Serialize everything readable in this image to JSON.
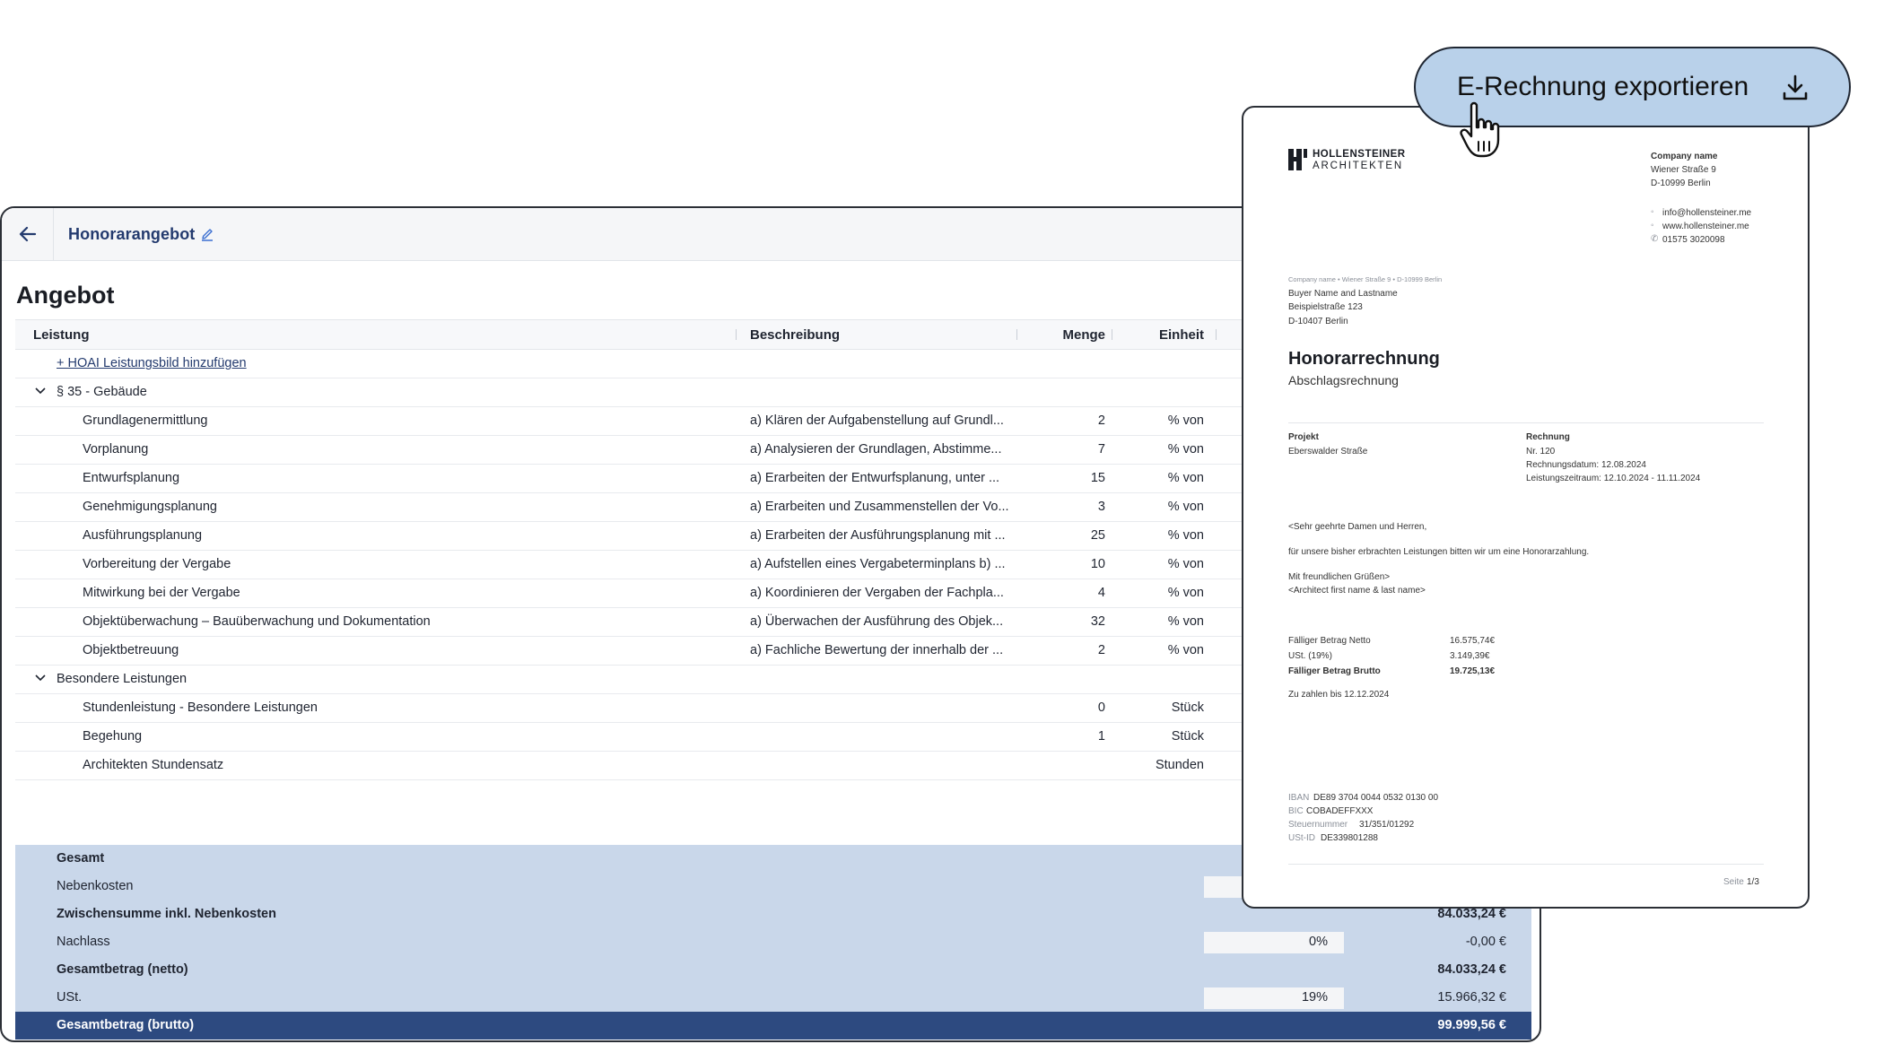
{
  "header": {
    "title": "Honorarangebot"
  },
  "page_title": "Angebot",
  "columns": {
    "leistung": "Leistung",
    "beschreibung": "Beschreibung",
    "menge": "Menge",
    "einheit": "Einheit"
  },
  "add_link": "+ HOAI Leistungsbild hinzufügen",
  "groups": [
    {
      "title": "§ 35 - Gebäude",
      "rows": [
        {
          "leistung": "Grundlagenermittlung",
          "beschreibung": "a) Klären der Aufgabenstellung auf Grundl...",
          "menge": "2",
          "einheit": "% von"
        },
        {
          "leistung": "Vorplanung",
          "beschreibung": "a) Analysieren der Grundlagen, Abstimme...",
          "menge": "7",
          "einheit": "% von"
        },
        {
          "leistung": "Entwurfsplanung",
          "beschreibung": "a) Erarbeiten der Entwurfsplanung, unter ...",
          "menge": "15",
          "einheit": "% von"
        },
        {
          "leistung": "Genehmigungsplanung",
          "beschreibung": "a) Erarbeiten und Zusammenstellen der Vo...",
          "menge": "3",
          "einheit": "% von"
        },
        {
          "leistung": "Ausführungsplanung",
          "beschreibung": "a) Erarbeiten der Ausführungsplanung mit ...",
          "menge": "25",
          "einheit": "% von"
        },
        {
          "leistung": "Vorbereitung der Vergabe",
          "beschreibung": "a) Aufstellen eines Vergabeterminplans b) ...",
          "menge": "10",
          "einheit": "% von"
        },
        {
          "leistung": "Mitwirkung bei der Vergabe",
          "beschreibung": "a) Koordinieren der Vergaben der Fachpla...",
          "menge": "4",
          "einheit": "% von"
        },
        {
          "leistung": "Objektüberwachung – Bauüberwachung und Dokumentation",
          "beschreibung": "a) Überwachen der Ausführung des Objek...",
          "menge": "32",
          "einheit": "% von"
        },
        {
          "leistung": "Objektbetreuung",
          "beschreibung": "a) Fachliche Bewertung der innerhalb der ...",
          "menge": "2",
          "einheit": "% von"
        }
      ]
    },
    {
      "title": "Besondere Leistungen",
      "rows": [
        {
          "leistung": "Stundenleistung - Besondere Leistungen",
          "beschreibung": "",
          "menge": "0",
          "einheit": "Stück"
        },
        {
          "leistung": "Begehung",
          "beschreibung": "",
          "menge": "1",
          "einheit": "Stück"
        },
        {
          "leistung": "Architekten Stundensatz",
          "beschreibung": "",
          "menge": "",
          "einheit": "Stunden"
        }
      ]
    }
  ],
  "totals": {
    "gesamt": "Gesamt",
    "nebenkosten": "Nebenkosten",
    "zwischensumme": "Zwischensumme inkl. Nebenkosten",
    "zwischensumme_amt": "84.033,24 €",
    "nachlass": "Nachlass",
    "nachlass_pct": "0%",
    "nachlass_amt": "-0,00 €",
    "netto": "Gesamtbetrag (netto)",
    "netto_amt": "84.033,24 €",
    "ust": "USt.",
    "ust_pct": "19%",
    "ust_amt": "15.966,32 €",
    "brutto": "Gesamtbetrag (brutto)",
    "brutto_amt": "99.999,56 €"
  },
  "export_button": "E-Rechnung exportieren",
  "invoice": {
    "logo_line1": "HOLLENSTEINER",
    "logo_line2": "ARCHITEKTEN",
    "company_name": "Company name",
    "company_street": "Wiener Straße 9",
    "company_city": "D-10999 Berlin",
    "email": "info@hollensteiner.me",
    "web": "www.hollensteiner.me",
    "phone": "01575 3020098",
    "sender_line": "Company name  •  Wiener Straße 9  •  D-10999 Berlin",
    "buyer_name": "Buyer Name and Lastname",
    "buyer_street": "Beispielstraße 123",
    "buyer_city": "D-10407 Berlin",
    "title": "Honorarrechnung",
    "subtitle": "Abschlagsrechnung",
    "projekt_label": "Projekt",
    "projekt_value": "Eberswalder Straße",
    "rechnung_label": "Rechnung",
    "rechnung_nr": "Nr. 120",
    "rechnung_datum": "Rechnungsdatum: 12.08.2024",
    "leistungszeitraum": "Leistungszeitraum: 12.10.2024 - 11.11.2024",
    "greeting": "<Sehr geehrte Damen und Herren,",
    "body": "für unsere bisher erbrachten Leistungen bitten wir um eine Honorarzahlung.",
    "closing1": "Mit freundlichen Grüßen>",
    "closing2": "<Architect first name & last name>",
    "netto_label": "Fälliger Betrag Netto",
    "netto_value": "16.575,74€",
    "ust_label": "USt. (19%)",
    "ust_value": "3.149,39€",
    "brutto_label": "Fälliger Betrag Brutto",
    "brutto_value": "19.725,13€",
    "due": "Zu zahlen bis 12.12.2024",
    "iban_label": "IBAN",
    "iban": "DE89 3704 0044 0532 0130 00",
    "bic_label": "BIC",
    "bic": "COBADEFFXXX",
    "steuer_label": "Steuernummer",
    "steuer": "31/351/01292",
    "ustid_label": "USt-ID",
    "ustid": "DE339801288",
    "page_label": "Seite",
    "page_value": "1/3"
  }
}
